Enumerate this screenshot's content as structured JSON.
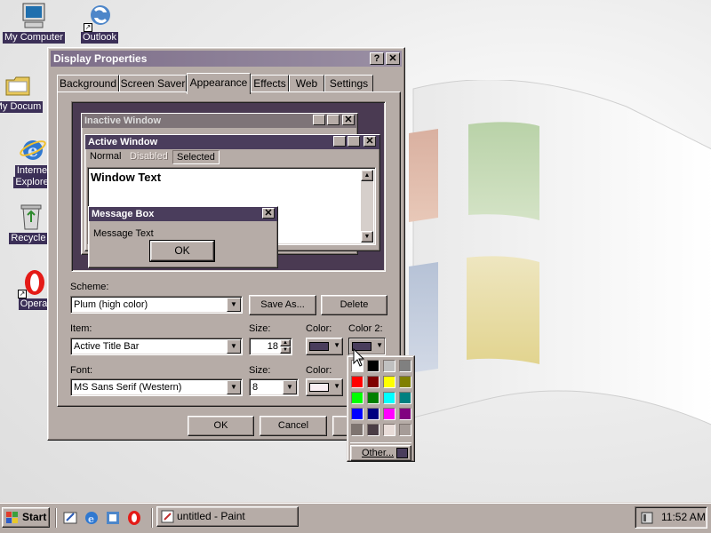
{
  "desktop": {
    "icons": [
      {
        "label": "My Computer",
        "icon": "computer-icon"
      },
      {
        "label": "Outlook",
        "icon": "outlook-icon"
      },
      {
        "label": "My Docum",
        "icon": "folder-icon"
      },
      {
        "label": "Interne",
        "label2": "Explore",
        "icon": "internet-explorer-icon"
      },
      {
        "label": "Recycle I",
        "icon": "recycle-bin-icon"
      },
      {
        "label": "Opera",
        "icon": "opera-icon"
      }
    ]
  },
  "dialog": {
    "title": "Display Properties",
    "help_glyph": "?",
    "close_glyph": "✕",
    "tabs": [
      "Background",
      "Screen Saver",
      "Appearance",
      "Effects",
      "Web",
      "Settings"
    ],
    "active_tab": "Appearance",
    "preview": {
      "inactive_title": "Inactive Window",
      "active_title": "Active Window",
      "menu_normal": "Normal",
      "menu_disabled": "Disabled",
      "menu_selected": "Selected",
      "window_text": "Window Text",
      "msgbox_title": "Message Box",
      "msgbox_text": "Message Text",
      "msgbox_ok": "OK"
    },
    "scheme_label": "Scheme:",
    "scheme_value": "Plum (high color)",
    "save_as": "Save As...",
    "delete": "Delete",
    "item_label": "Item:",
    "item_value": "Active Title Bar",
    "item_size_label": "Size:",
    "item_size_value": "18",
    "color_label": "Color:",
    "color2_label": "Color 2:",
    "font_label": "Font:",
    "font_value": "MS Sans Serif (Western)",
    "font_size_label": "Size:",
    "font_size_value": "8",
    "font_color_label": "Color:",
    "ok": "OK",
    "cancel": "Cancel",
    "colors": {
      "item_color": "#4a3d5c",
      "item_color2": "#4a3d5c",
      "font_color": "#fbf0f4"
    }
  },
  "color_popup": {
    "palette": [
      "#ffffff",
      "#000000",
      "#c0c0c0",
      "#808080",
      "#ff0000",
      "#800000",
      "#ffff00",
      "#808000",
      "#00ff00",
      "#008000",
      "#00ffff",
      "#008080",
      "#0000ff",
      "#000080",
      "#ff00ff",
      "#800080",
      "#7e7470",
      "#4a3d45",
      "#e8dcd8",
      "#a69c98"
    ],
    "other_label": "Other...",
    "other_swatch": "#4a3d5c"
  },
  "taskbar": {
    "start_label": "Start",
    "quicklaunch": [
      "show-desktop-icon",
      "internet-explorer-icon",
      "outlook-icon",
      "opera-icon"
    ],
    "task_label": "untitled - Paint",
    "time": "11:52 AM"
  }
}
